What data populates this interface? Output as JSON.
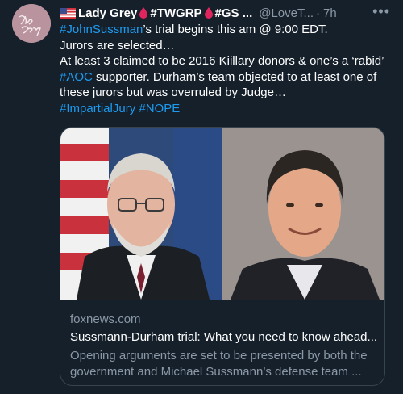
{
  "author": {
    "name": "Lady Grey",
    "tag1": "#TWGRP",
    "tag2": "#GS ...",
    "handle": "@LoveT...",
    "dot": "·",
    "time": "7h",
    "avatar_text": "Lady Grey"
  },
  "tweet": {
    "line1_tag": "#JohnSussman",
    "line1_rest": "’s trial begins this am @ 9:00 EDT.",
    "line2": "Jurors are selected…",
    "line3": "At least 3 claimed to be 2016 Kiillary donors & one’s a ‘rabid’",
    "line4_tag": "#AOC",
    "line4_rest": " supporter. Durham’s team objected to at least one of",
    "line5": "these jurors but was overruled by Judge…",
    "hashtag1": "#ImpartialJury",
    "hashtag2": "#NOPE"
  },
  "card": {
    "domain": "foxnews.com",
    "title": "Sussmann-Durham trial: What you need to know ahead...",
    "description": "Opening arguments are set to be presented by both the government and Michael Sussmann’s defense team ..."
  },
  "colors": {
    "background": "#15202b",
    "link": "#1d9bf0",
    "secondary_text": "#8b98a5",
    "border": "#38444d",
    "drop": "#e0245e"
  },
  "icons": {
    "flag": "us-flag-icon",
    "drop": "blood-drop-icon",
    "more": "more-options-icon"
  }
}
